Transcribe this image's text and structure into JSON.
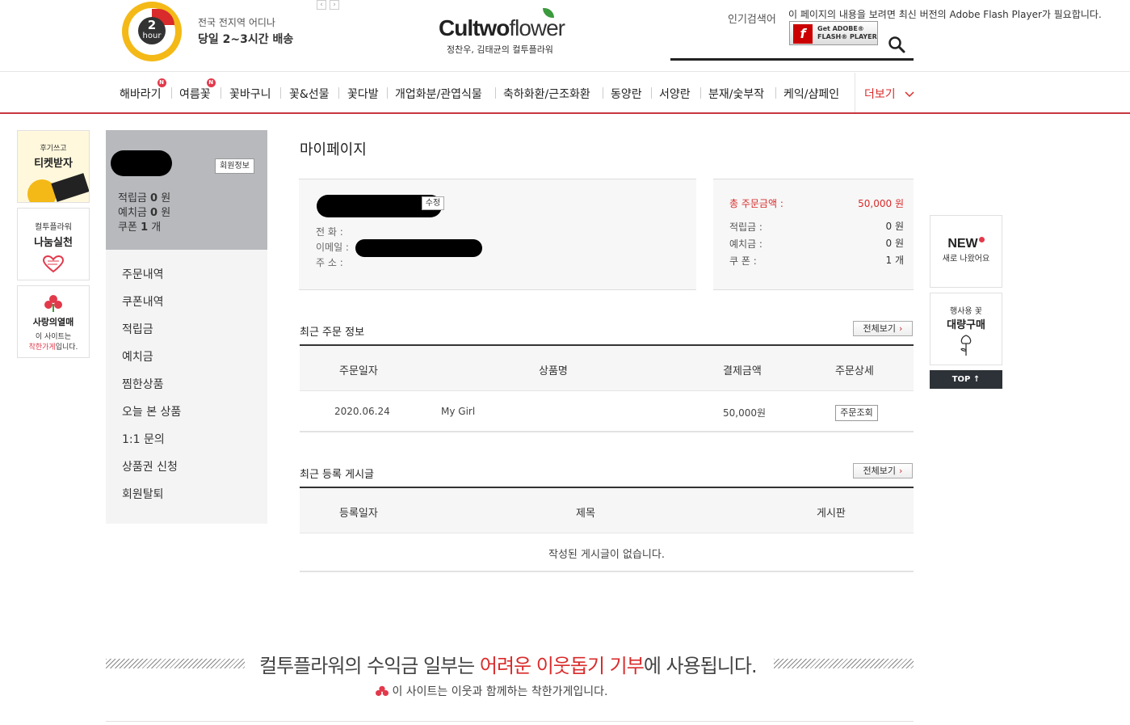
{
  "header": {
    "hour_number": "2",
    "hour_unit": "hour",
    "tagline_sub": "전국 전지역 어디나",
    "tagline_main": "당일 2~3시간 배송",
    "prev_arrow": "‹",
    "next_arrow": "›",
    "logo_a": "Cultwo",
    "logo_b": "flower",
    "logo_sub": "정찬우, 김태균의 컬투플라워",
    "popular_label": "인기검색어",
    "flash_message": "이 페이지의 내용을 보려면 최신 버전의 Adobe Flash Player가 필요합니다.",
    "flash_btn_line1": "Get ADOBE®",
    "flash_btn_line2": "FLASH® PLAYER",
    "flash_logo": "f"
  },
  "nav": {
    "items": [
      {
        "label": "해바라기",
        "badge": "N"
      },
      {
        "label": "여름꽃",
        "badge": "N"
      },
      {
        "label": "꽃바구니"
      },
      {
        "label": "꽃&선물"
      },
      {
        "label": "꽃다발"
      },
      {
        "label": "개업화분/관엽식물"
      },
      {
        "label": "축하화환/근조화환"
      },
      {
        "label": "동양란"
      },
      {
        "label": "서양란"
      },
      {
        "label": "분재/숯부작"
      },
      {
        "label": "케익/샴페인"
      }
    ],
    "more_label": "더보기"
  },
  "left_banners": {
    "b1_top": "후기쓰고",
    "b1_main": "티켓받자",
    "b2_top": "컬투플라워",
    "b2_main": "나눔실천",
    "b3_main": "사랑의열매",
    "b3_line1": "이 사이트는",
    "b3_line2_red": "착한가게",
    "b3_line2_rest": "입니다."
  },
  "sidebar": {
    "member_info_button": "회원정보",
    "points_label": "적립금",
    "points_value": "0",
    "points_unit": "원",
    "deposit_label": "예치금",
    "deposit_value": "0",
    "deposit_unit": "원",
    "coupon_label": "쿠폰",
    "coupon_value": "1",
    "coupon_unit": "개",
    "menu": [
      "주문내역",
      "쿠폰내역",
      "적립금",
      "예치금",
      "찜한상품",
      "오늘 본 상품",
      "1:1 문의",
      "상품권 신청",
      "회원탈퇴"
    ]
  },
  "main": {
    "page_title": "마이페이지",
    "info": {
      "edit_button": "수정",
      "phone_label": "전  화 :",
      "email_label": "이메일 :",
      "address_label": "주  소 :"
    },
    "summary": {
      "total_label": "총 주문금액 :",
      "total_value": "50,000 원",
      "points_label": "적립금 :",
      "points_value": "0 원",
      "deposit_label": "예치금 :",
      "deposit_value": "0 원",
      "coupon_label": "쿠  폰 :",
      "coupon_value": "1 개"
    },
    "recent_orders": {
      "title": "최근 주문 정보",
      "view_all": "전체보기",
      "columns": [
        "주문일자",
        "상품명",
        "결제금액",
        "주문상세"
      ],
      "rows": [
        {
          "date": "2020.06.24",
          "product": "My Girl",
          "amount": "50,000원",
          "detail_button": "주문조회"
        }
      ]
    },
    "recent_posts": {
      "title": "최근 등록 게시글",
      "view_all": "전체보기",
      "columns": [
        "등록일자",
        "제목",
        "게시판"
      ],
      "empty_message": "작성된 게시글이 없습니다."
    }
  },
  "right_banners": {
    "new_title": "NEW",
    "new_sub": "새로 나왔어요",
    "bulk_top": "행사용 꽃",
    "bulk_main": "대량구매",
    "top_button": "TOP"
  },
  "footer": {
    "donate_a": "컬투플라워의 수익금 일부는 ",
    "donate_red": "어려운 이웃돕기 기부",
    "donate_b": "에 사용됩니다.",
    "donate_sub": "이 사이트는 이웃과 함께하는 착한가게입니다."
  },
  "colors": {
    "accent_red": "#d92b2b",
    "badge_yellow": "#f4b916",
    "sidebar_gray": "#b7b9bd"
  }
}
